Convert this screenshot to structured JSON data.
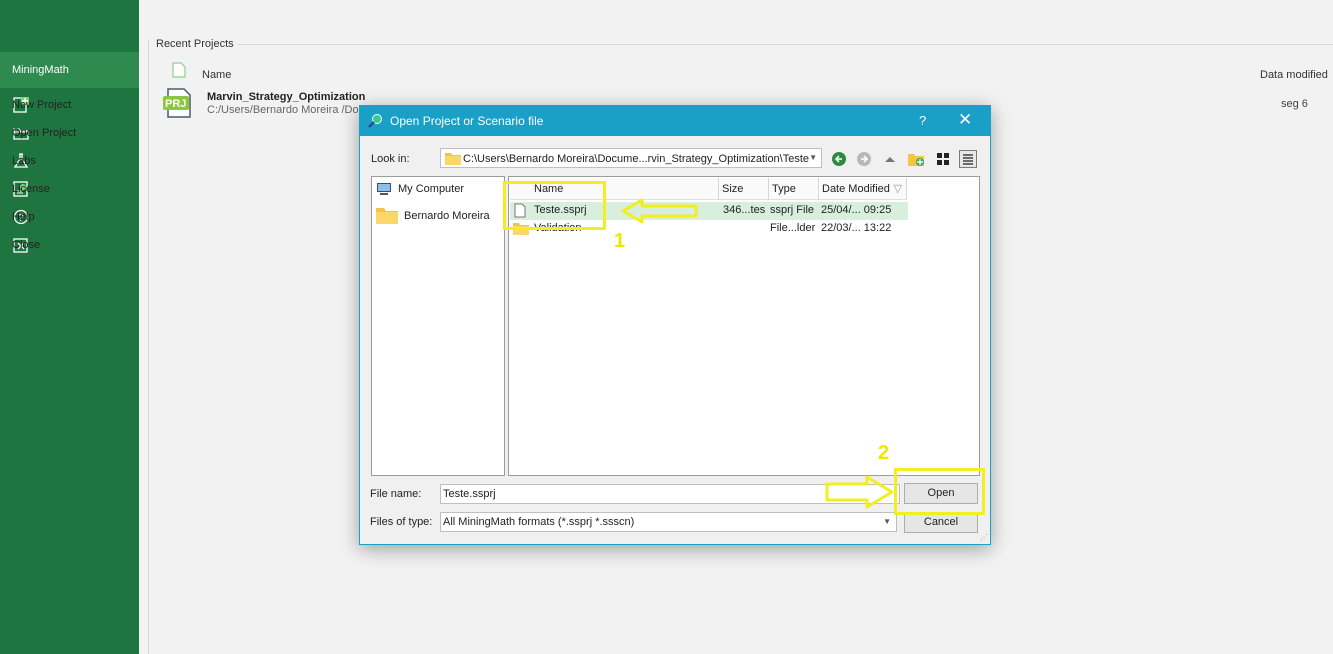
{
  "sidebar": {
    "app_name": "MiningMath",
    "items": [
      {
        "label": "New Project",
        "icon": "new-project-icon"
      },
      {
        "label": "Open Project",
        "icon": "folder-open-icon"
      },
      {
        "label": "Labs",
        "icon": "flask-icon"
      },
      {
        "label": "License",
        "icon": "license-icon"
      },
      {
        "label": "Help",
        "icon": "help-icon"
      },
      {
        "label": "Close",
        "icon": "close-icon"
      }
    ]
  },
  "recent": {
    "title": "Recent Projects",
    "col_name": "Name",
    "col_modified": "Data modified",
    "projects": [
      {
        "name": "Marvin_Strategy_Optimization",
        "path": "C:/Users/Bernardo Moreira /Docu",
        "modified": "seg 6",
        "badge": "PRJ"
      }
    ]
  },
  "dialog": {
    "title": "Open Project or Scenario file",
    "help": "?",
    "close": "✕",
    "look_in_label": "Look in:",
    "look_in_path": "C:\\Users\\Bernardo Moreira\\Docume...rvin_Strategy_Optimization\\Teste",
    "places": [
      {
        "label": "My Computer"
      },
      {
        "label": "Bernardo Moreira"
      }
    ],
    "columns": [
      "Name",
      "Size",
      "Type",
      "Date Modified"
    ],
    "files": [
      {
        "name": "Teste.ssprj",
        "size": "346...tes",
        "type": "ssprj File",
        "date": "25/04/... 09:25"
      },
      {
        "name": "Validation",
        "size": "",
        "type": "File...lder",
        "date": "22/03/... 13:22"
      }
    ],
    "file_name_label": "File name:",
    "file_name_value": "Teste.ssprj",
    "file_type_label": "Files of type:",
    "file_type_value": "All MiningMath formats (*.ssprj *.ssscn)",
    "open_button": "Open",
    "cancel_button": "Cancel"
  },
  "annotations": {
    "step1": "1",
    "step2": "2",
    "color": "#f2ee1f"
  }
}
